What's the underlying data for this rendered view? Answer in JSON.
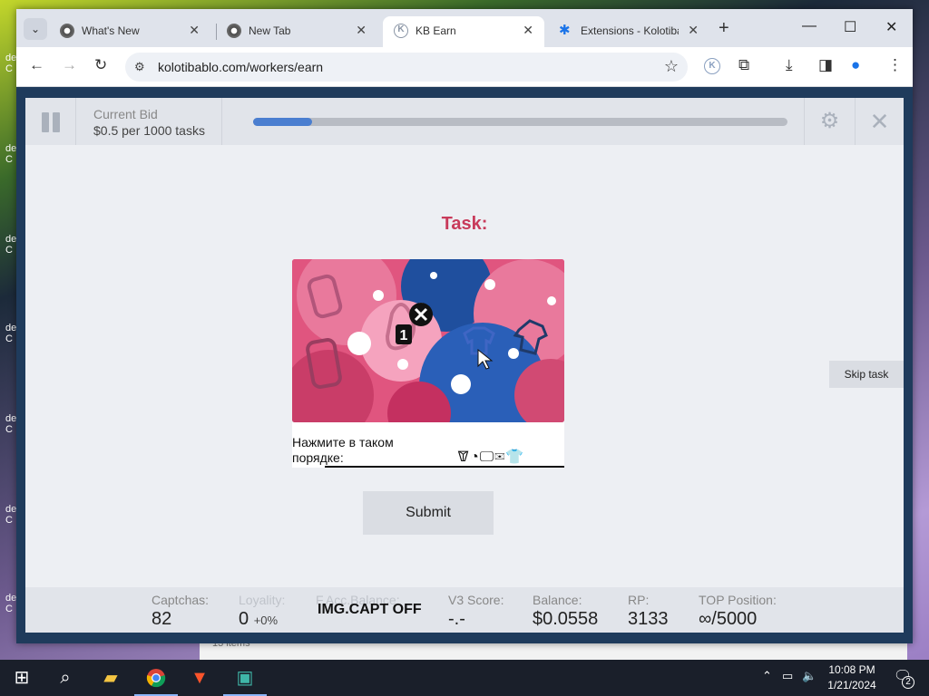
{
  "browser": {
    "tabs": [
      {
        "title": "What's New",
        "favicon": "chrome-icon"
      },
      {
        "title": "New Tab",
        "favicon": "chrome-icon"
      },
      {
        "title": "KB Earn",
        "favicon": "kb-icon",
        "active": true
      },
      {
        "title": "Extensions - Kolotiba",
        "favicon": "puzzle-icon"
      }
    ],
    "url": "kolotibablo.com/workers/earn",
    "ext_badge": "K"
  },
  "kb": {
    "bid_label": "Current Bid",
    "bid_value": "$0.5 per 1000 tasks",
    "progress_fraction": 0.11,
    "task_title": "Task:",
    "captcha": {
      "instruction": "Нажмите в таком порядке:",
      "sequence": "🝩◔🖵✉👕",
      "click_marker": "1"
    },
    "submit_label": "Submit",
    "skip_label": "Skip task",
    "img_capt_status": "IMG.CAPT OFF",
    "stats": [
      {
        "label": "Captchas:",
        "value": "82",
        "suffix": ""
      },
      {
        "label": "Loyality:",
        "value": "0",
        "suffix": "+0%"
      },
      {
        "label": "F.Acc.Balance:",
        "value": "",
        "suffix": ""
      },
      {
        "label": "V3 Score:",
        "value": "-.-",
        "suffix": ""
      },
      {
        "label": "Balance:",
        "value": "$0.0558",
        "suffix": ""
      },
      {
        "label": "RP:",
        "value": "3133",
        "suffix": ""
      },
      {
        "label": "TOP Position:",
        "value": "∞/5000",
        "suffix": ""
      }
    ]
  },
  "background_window": {
    "items_text": "13 items"
  },
  "taskbar": {
    "time": "10:08 PM",
    "date": "1/21/2024",
    "notifications": "2"
  }
}
